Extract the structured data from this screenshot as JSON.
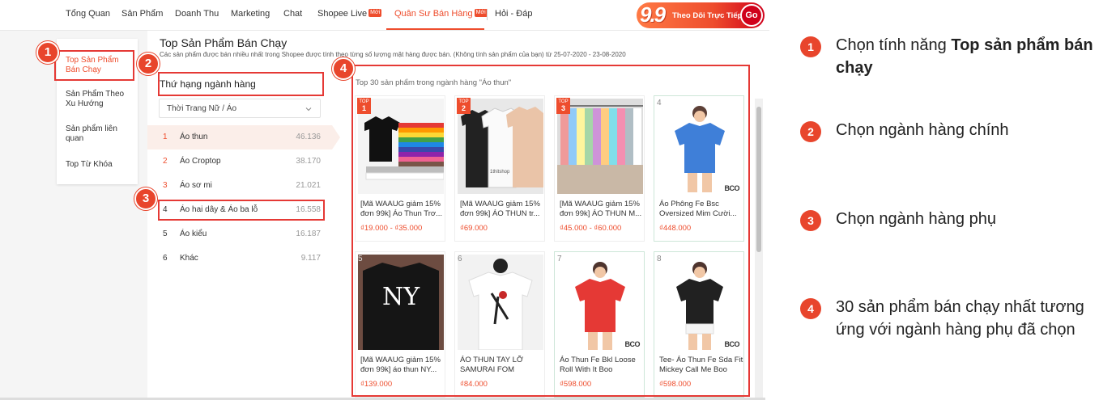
{
  "nav": {
    "items": [
      "Tổng Quan",
      "Sản Phẩm",
      "Doanh Thu",
      "Marketing",
      "Chat",
      "Shopee Live",
      "Quân Sư Bán Hàng",
      "Hỏi - Đáp"
    ],
    "moi": "Mới",
    "banner_big": "9.9",
    "banner_text": "Theo Dõi Trực Tiếp",
    "banner_go": "Go"
  },
  "left_menu": {
    "items": [
      "Top Sản Phẩm Bán Chạy",
      "Sản Phẩm Theo Xu Hướng",
      "Sản phẩm liên quan",
      "Top Từ Khóa"
    ]
  },
  "content": {
    "title": "Top Sản Phẩm Bán Chạy",
    "subtitle": "Các sản phẩm được bán nhiều nhất trong Shopee được tính theo từng số lượng mặt hàng được bán. (Không tính sản phẩm của bạn) từ 25-07-2020 - 23-08-2020"
  },
  "ranking": {
    "heading": "Thứ hạng ngành hàng",
    "select_value": "Thời Trang Nữ / Áo",
    "rows": [
      {
        "num": "1",
        "name": "Áo thun",
        "count": "46.136"
      },
      {
        "num": "2",
        "name": "Áo Croptop",
        "count": "38.170"
      },
      {
        "num": "3",
        "name": "Áo sơ mi",
        "count": "21.021"
      },
      {
        "num": "4",
        "name": "Áo hai dây & Áo ba lỗ",
        "count": "16.558"
      },
      {
        "num": "5",
        "name": "Áo kiểu",
        "count": "16.187"
      },
      {
        "num": "6",
        "name": "Khác",
        "count": "9.117"
      }
    ]
  },
  "products": {
    "caption": "Top 30 sản phẩm trong ngành hàng \"Áo thun\"",
    "top_label": "TOP",
    "brand": "BCO",
    "shirt_text": "1thitshop",
    "items": [
      {
        "rank": "1",
        "name": "[Mã WAAUG giảm 15% đơn 99k] Áo Thun Trơ...",
        "price": "₫19.000 - ₫35.000"
      },
      {
        "rank": "2",
        "name": "[Mã WAAUG giảm 15% đơn 99k] ÁO THUN tr...",
        "price": "₫69.000"
      },
      {
        "rank": "3",
        "name": "[Mã WAAUG giảm 15% đơn 99k] ÁO THUN M...",
        "price": "₫45.000 - ₫60.000"
      },
      {
        "rank": "4",
        "name": "Áo Phông Fe Bsc Oversized Mim Cười...",
        "price": "₫448.000"
      },
      {
        "rank": "5",
        "name": "[Mã WAAUG giảm 15% đơn 99k] áo thun NY...",
        "price": "₫139.000"
      },
      {
        "rank": "6",
        "name": "ÁO THUN TAY LỠ SAMURAI FOM RỘNG...",
        "price": "₫84.000"
      },
      {
        "rank": "7",
        "name": "Áo Thun Fe Bkl Loose Roll With It Boo",
        "price": "₫598.000"
      },
      {
        "rank": "8",
        "name": "Tee- Áo Thun Fe Sda Fit Mickey Call Me Boo",
        "price": "₫598.000"
      }
    ]
  },
  "steps": [
    "1",
    "2",
    "3",
    "4"
  ],
  "legend": [
    {
      "num": "1",
      "text": "Chọn tính năng ",
      "bold": "Top sản phẩm bán chạy"
    },
    {
      "num": "2",
      "text": "Chọn ngành hàng chính",
      "bold": ""
    },
    {
      "num": "3",
      "text": "Chọn ngành hàng phụ",
      "bold": ""
    },
    {
      "num": "4",
      "text": "30 sản phẩm bán chạy nhất tương ứng với ngành hàng phụ đã chọn",
      "bold": ""
    }
  ],
  "colors": {
    "accent": "#ee4d2d",
    "annotation": "#e53935"
  }
}
